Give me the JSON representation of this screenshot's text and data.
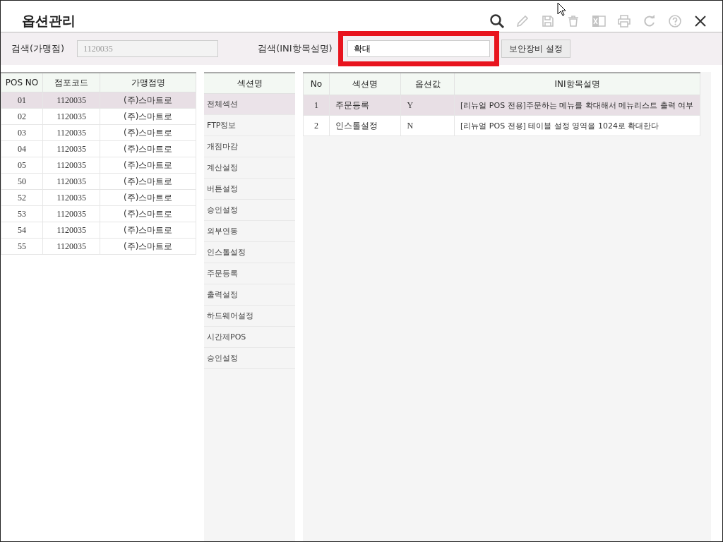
{
  "window": {
    "title": "옵션관리"
  },
  "toolbar": [
    {
      "kind": "search",
      "disabled": false
    },
    {
      "kind": "edit",
      "disabled": true
    },
    {
      "kind": "save",
      "disabled": true
    },
    {
      "kind": "delete",
      "disabled": true
    },
    {
      "kind": "excel",
      "disabled": true
    },
    {
      "kind": "print",
      "disabled": true
    },
    {
      "kind": "refresh",
      "disabled": true
    },
    {
      "kind": "help",
      "disabled": true
    },
    {
      "kind": "close",
      "disabled": false
    }
  ],
  "search": {
    "store_label": "검색(가맹점)",
    "store_value": "1120035",
    "ini_label": "검색(INI항목설명)",
    "ini_value": "확대",
    "ini_highlighted": true,
    "button": "보안장비 설정"
  },
  "pos_table": {
    "columns": [
      "POS NO",
      "점포코드",
      "가맹점명"
    ],
    "rows": [
      {
        "cells": [
          "01",
          "1120035",
          "(주)스마트로"
        ],
        "selected": true
      },
      {
        "cells": [
          "02",
          "1120035",
          "(주)스마트로"
        ],
        "selected": false
      },
      {
        "cells": [
          "03",
          "1120035",
          "(주)스마트로"
        ],
        "selected": false
      },
      {
        "cells": [
          "04",
          "1120035",
          "(주)스마트로"
        ],
        "selected": false
      },
      {
        "cells": [
          "05",
          "1120035",
          "(주)스마트로"
        ],
        "selected": false
      },
      {
        "cells": [
          "50",
          "1120035",
          "(주)스마트로"
        ],
        "selected": false
      },
      {
        "cells": [
          "52",
          "1120035",
          "(주)스마트로"
        ],
        "selected": false
      },
      {
        "cells": [
          "53",
          "1120035",
          "(주)스마트로"
        ],
        "selected": false
      },
      {
        "cells": [
          "54",
          "1120035",
          "(주)스마트로"
        ],
        "selected": false
      },
      {
        "cells": [
          "55",
          "1120035",
          "(주)스마트로"
        ],
        "selected": false
      }
    ]
  },
  "sections": {
    "header": "섹션명",
    "items": [
      {
        "label": "전체섹션",
        "selected": true
      },
      {
        "label": "FTP정보",
        "selected": false
      },
      {
        "label": "개점마감",
        "selected": false
      },
      {
        "label": "계산설정",
        "selected": false
      },
      {
        "label": "버튼설정",
        "selected": false
      },
      {
        "label": "승인설정",
        "selected": false
      },
      {
        "label": "외부연동",
        "selected": false
      },
      {
        "label": "인스톨설정",
        "selected": false
      },
      {
        "label": "주문등록",
        "selected": false
      },
      {
        "label": "출력설정",
        "selected": false
      },
      {
        "label": "하드웨어설정",
        "selected": false
      },
      {
        "label": "시간제POS",
        "selected": false
      },
      {
        "label": "승인설정",
        "selected": false
      }
    ]
  },
  "option_table": {
    "columns": [
      "No",
      "섹션명",
      "옵션값",
      "INI항목설명"
    ],
    "rows": [
      {
        "cells": [
          "1",
          "주문등록",
          "Y",
          "[리뉴얼 POS 전용]주문하는 메뉴를 확대해서 메뉴리스트 출력 여부"
        ],
        "selected": true
      },
      {
        "cells": [
          "2",
          "인스톨설정",
          "N",
          "[리뉴얼 POS 전용] 테이블 설정 영역을 1024로 확대한다"
        ],
        "selected": false
      }
    ]
  }
}
